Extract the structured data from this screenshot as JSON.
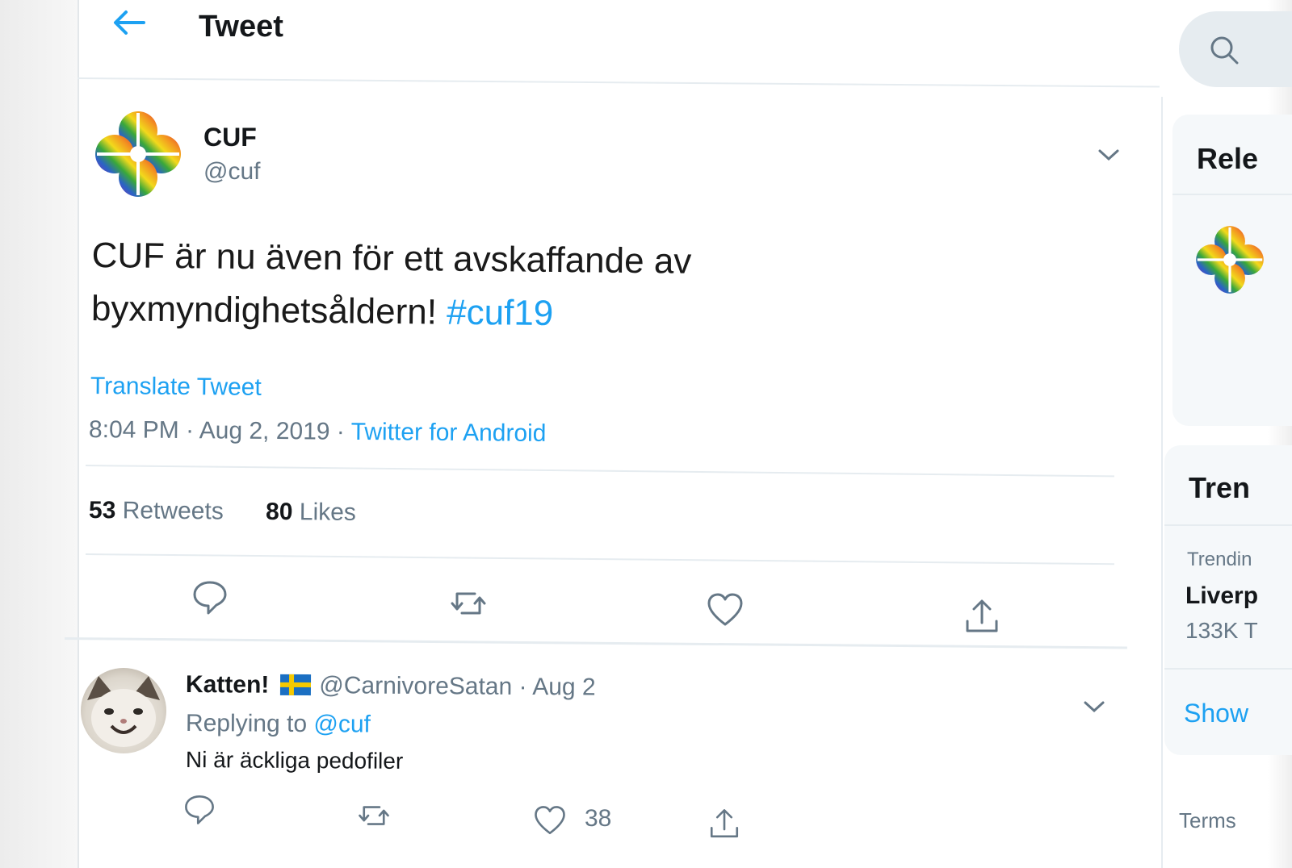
{
  "colors": {
    "accent": "#1da1f2",
    "text": "#14171a",
    "muted": "#657786",
    "divider": "#e6ecf0"
  },
  "header": {
    "back_icon": "arrow-left-icon",
    "title": "Tweet"
  },
  "tweet": {
    "author_name": "CUF",
    "author_handle": "@cuf",
    "avatar_icon": "rainbow-clover-logo",
    "text": "CUF är nu även för ett avskaffande av byxmyndighetsåldern! ",
    "hashtag": "#cuf19",
    "translate_label": "Translate Tweet",
    "time": "8:04 PM",
    "date": "Aug 2, 2019",
    "source": "Twitter for Android",
    "separator": " · ",
    "retweet_count": "53",
    "retweet_label": "Retweets",
    "like_count": "80",
    "like_label": "Likes",
    "actions": [
      "reply-icon",
      "retweet-icon",
      "like-icon",
      "share-icon"
    ]
  },
  "reply": {
    "author_name": "Katten!",
    "flag": "sweden-flag",
    "author_handle": "@CarnivoreSatan",
    "separator": " · ",
    "date": "Aug 2",
    "replying_to_label": "Replying to ",
    "replying_to_handle": "@cuf",
    "text": "Ni är äckliga pedofiler",
    "like_count": "38",
    "actions": [
      "reply-icon",
      "retweet-icon",
      "like-icon",
      "share-icon"
    ]
  },
  "sidebar": {
    "search_icon": "search-icon",
    "relevant_title": "Rele",
    "trends_title": "Tren",
    "trend_label": "Trendin",
    "trend_name": "Liverp",
    "trend_count": "133K T",
    "show_more": "Show",
    "terms": "Terms"
  }
}
